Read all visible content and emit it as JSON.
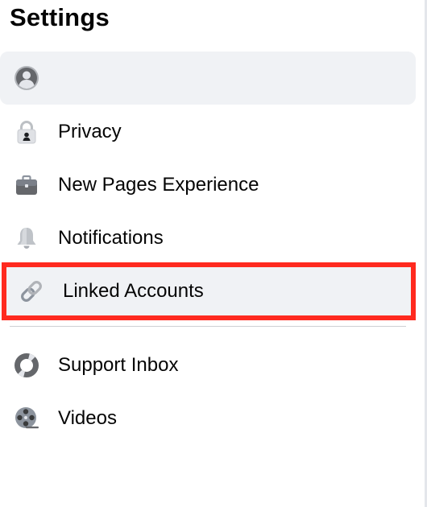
{
  "header": {
    "title": "Settings"
  },
  "menu": {
    "profile": {
      "label": "",
      "icon": "profile-icon"
    },
    "items": [
      {
        "label": "Privacy",
        "icon": "lock-icon"
      },
      {
        "label": "New Pages Experience",
        "icon": "briefcase-icon"
      },
      {
        "label": "Notifications",
        "icon": "bell-icon"
      },
      {
        "label": "Linked Accounts",
        "icon": "link-icon",
        "highlighted": true
      }
    ],
    "secondary": [
      {
        "label": "Support Inbox",
        "icon": "lifebuoy-icon"
      },
      {
        "label": "Videos",
        "icon": "film-reel-icon"
      }
    ]
  },
  "colors": {
    "highlight_border": "#ff2a1f",
    "row_background": "#f0f2f5",
    "icon_gray": "#65676b"
  }
}
